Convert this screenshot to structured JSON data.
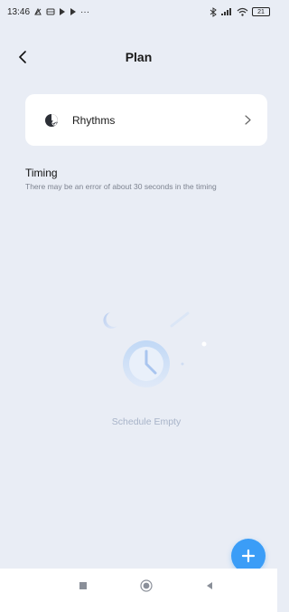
{
  "status_bar": {
    "time": "13:46",
    "left_icons": [
      "notification-icon",
      "message-icon",
      "play-icon",
      "play-icon",
      "more-icon"
    ],
    "more_text": "···",
    "right_icons": [
      "bluetooth-icon",
      "signal-icon",
      "wifi-icon",
      "battery-icon"
    ],
    "battery_level": "21"
  },
  "header": {
    "title": "Plan",
    "back_icon": "chevron-left-icon"
  },
  "card": {
    "icon": "rhythm-icon",
    "label": "Rhythms",
    "chevron_icon": "chevron-right-icon"
  },
  "timing": {
    "title": "Timing",
    "description": "There may be an error of about 30 seconds in the timing"
  },
  "empty_state": {
    "illustration": "clock-icon",
    "text": "Schedule Empty"
  },
  "fab": {
    "icon": "plus-icon"
  },
  "nav_bar": {
    "icons": [
      "square-icon",
      "circle-icon",
      "triangle-back-icon"
    ]
  },
  "colors": {
    "background": "#e9edf5",
    "accent": "#3b9df7",
    "empty_text": "#a7b3c8"
  }
}
